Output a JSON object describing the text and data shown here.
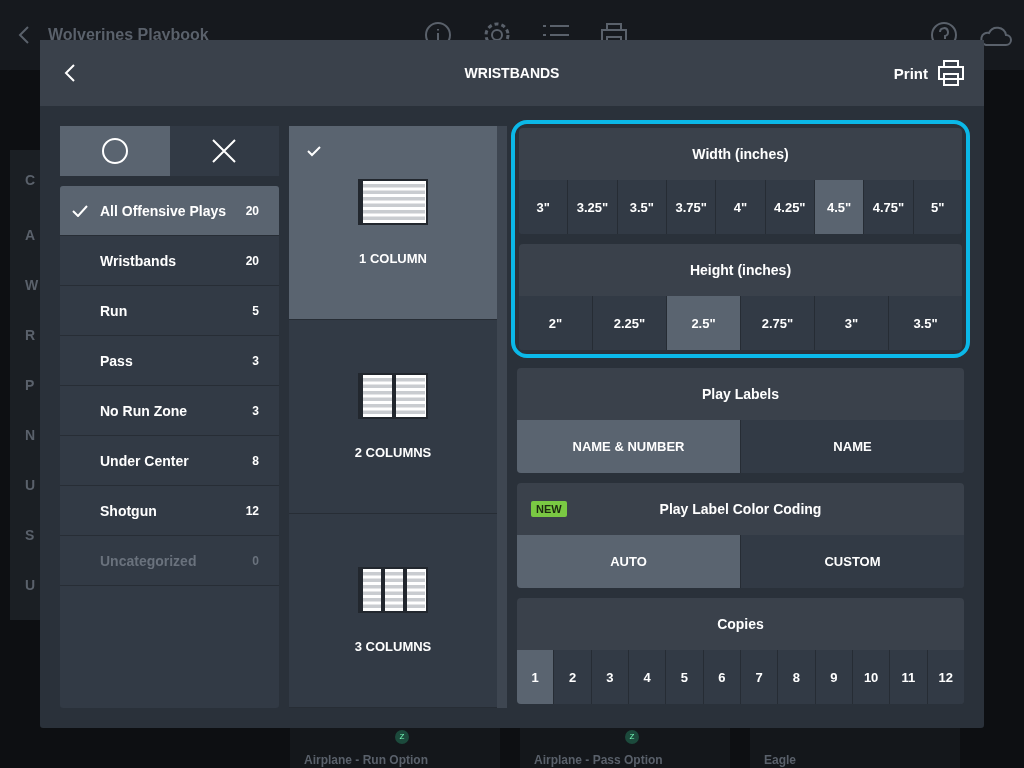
{
  "background": {
    "title": "Wolverines Playbook",
    "sidebar_fragments": [
      "C",
      "A",
      "W",
      "R",
      "P",
      "N",
      "U",
      "S",
      "U"
    ],
    "cards": [
      {
        "title": "Airplane - Run Option",
        "badge": "Z"
      },
      {
        "title": "Airplane - Pass Option",
        "badge": "Z"
      },
      {
        "title": "Eagle"
      }
    ]
  },
  "dialog": {
    "title": "WRISTBANDS",
    "print_label": "Print"
  },
  "mode_toggle": [
    {
      "kind": "circle",
      "selected": true
    },
    {
      "kind": "cross",
      "selected": false
    }
  ],
  "categories": [
    {
      "label": "All Offensive Plays",
      "count": "20",
      "selected": true,
      "disabled": false
    },
    {
      "label": "Wristbands",
      "count": "20",
      "selected": false,
      "disabled": false
    },
    {
      "label": "Run",
      "count": "5",
      "selected": false,
      "disabled": false
    },
    {
      "label": "Pass",
      "count": "3",
      "selected": false,
      "disabled": false
    },
    {
      "label": "No Run Zone",
      "count": "3",
      "selected": false,
      "disabled": false
    },
    {
      "label": "Under Center",
      "count": "8",
      "selected": false,
      "disabled": false
    },
    {
      "label": "Shotgun",
      "count": "12",
      "selected": false,
      "disabled": false
    },
    {
      "label": "Uncategorized",
      "count": "0",
      "selected": false,
      "disabled": true
    }
  ],
  "layouts": [
    {
      "label": "1 COLUMN",
      "kind": "one",
      "selected": true
    },
    {
      "label": "2 COLUMNS",
      "kind": "two",
      "selected": false
    },
    {
      "label": "3 COLUMNS",
      "kind": "three",
      "selected": false
    }
  ],
  "size": {
    "highlighted": true,
    "width": {
      "label": "Width (inches)",
      "options": [
        {
          "label": "3\"",
          "selected": false
        },
        {
          "label": "3.25\"",
          "selected": false
        },
        {
          "label": "3.5\"",
          "selected": false
        },
        {
          "label": "3.75\"",
          "selected": false
        },
        {
          "label": "4\"",
          "selected": false
        },
        {
          "label": "4.25\"",
          "selected": false
        },
        {
          "label": "4.5\"",
          "selected": true
        },
        {
          "label": "4.75\"",
          "selected": false
        },
        {
          "label": "5\"",
          "selected": false
        }
      ]
    },
    "height": {
      "label": "Height (inches)",
      "options": [
        {
          "label": "2\"",
          "selected": false
        },
        {
          "label": "2.25\"",
          "selected": false
        },
        {
          "label": "2.5\"",
          "selected": true
        },
        {
          "label": "2.75\"",
          "selected": false
        },
        {
          "label": "3\"",
          "selected": false
        },
        {
          "label": "3.5\"",
          "selected": false
        }
      ]
    }
  },
  "play_labels": {
    "label": "Play Labels",
    "options": [
      {
        "label": "NAME & NUMBER",
        "selected": true
      },
      {
        "label": "NAME",
        "selected": false
      }
    ]
  },
  "color_coding": {
    "badge": "NEW",
    "label": "Play Label Color Coding",
    "options": [
      {
        "label": "AUTO",
        "selected": true
      },
      {
        "label": "CUSTOM",
        "selected": false
      }
    ]
  },
  "copies": {
    "label": "Copies",
    "options": [
      {
        "label": "1",
        "selected": true
      },
      {
        "label": "2",
        "selected": false
      },
      {
        "label": "3",
        "selected": false
      },
      {
        "label": "4",
        "selected": false
      },
      {
        "label": "5",
        "selected": false
      },
      {
        "label": "6",
        "selected": false
      },
      {
        "label": "7",
        "selected": false
      },
      {
        "label": "8",
        "selected": false
      },
      {
        "label": "9",
        "selected": false
      },
      {
        "label": "10",
        "selected": false
      },
      {
        "label": "11",
        "selected": false
      },
      {
        "label": "12",
        "selected": false
      }
    ]
  }
}
